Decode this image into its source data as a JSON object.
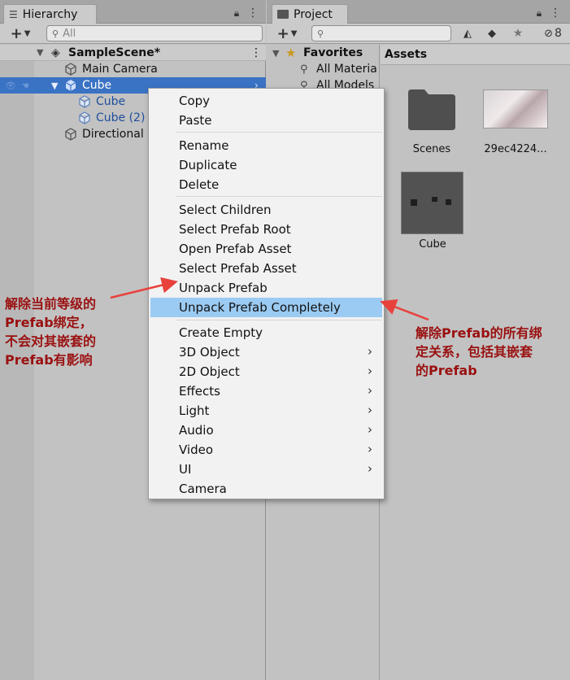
{
  "hierarchy": {
    "tab_title": "Hierarchy",
    "search_placeholder": "All",
    "scene_name": "SampleScene*",
    "items": [
      {
        "label": "Main Camera",
        "icon": "cube-outline-icon"
      },
      {
        "label": "Cube",
        "icon": "prefab-cube-icon"
      },
      {
        "label": "Cube",
        "icon": "prefab-cube-icon"
      },
      {
        "label": "Cube (2)",
        "icon": "prefab-cube-icon"
      },
      {
        "label": "Directional",
        "icon": "cube-outline-icon"
      }
    ]
  },
  "project": {
    "tab_title": "Project",
    "hidden_count": "8",
    "favorites": {
      "label": "Favorites",
      "items": [
        "All Materia",
        "All Models"
      ]
    },
    "assets_header": "Assets",
    "assets": [
      {
        "label": "Scenes",
        "type": "folder"
      },
      {
        "label": "29ec4224...",
        "type": "image"
      },
      {
        "label": "Cube",
        "type": "prefab"
      }
    ]
  },
  "context_menu": {
    "items": [
      {
        "label": "Copy"
      },
      {
        "label": "Paste"
      },
      {
        "label": "Rename"
      },
      {
        "label": "Duplicate"
      },
      {
        "label": "Delete"
      },
      {
        "label": "Select Children"
      },
      {
        "label": "Select Prefab Root"
      },
      {
        "label": "Open Prefab Asset"
      },
      {
        "label": "Select Prefab Asset"
      },
      {
        "label": "Unpack Prefab"
      },
      {
        "label": "Unpack Prefab Completely",
        "highlighted": true
      },
      {
        "label": "Create Empty"
      },
      {
        "label": "3D Object",
        "submenu": true
      },
      {
        "label": "2D Object",
        "submenu": true
      },
      {
        "label": "Effects",
        "submenu": true
      },
      {
        "label": "Light",
        "submenu": true
      },
      {
        "label": "Audio",
        "submenu": true
      },
      {
        "label": "Video",
        "submenu": true
      },
      {
        "label": "UI",
        "submenu": true
      },
      {
        "label": "Camera"
      }
    ]
  },
  "annotations": {
    "left": [
      "解除当前等级的",
      "Prefab绑定，",
      "不会对其嵌套的",
      "Prefab有影响"
    ],
    "right": [
      "解除Prefab的所有绑",
      "定关系，包括其嵌套",
      "的Prefab"
    ],
    "arrow_color": "#e8413c"
  },
  "colors": {
    "selection": "#3a72c4",
    "menu_highlight": "#9bcbf3",
    "prefab_text": "#1f4f9c",
    "annotation_text": "#9a1010"
  }
}
